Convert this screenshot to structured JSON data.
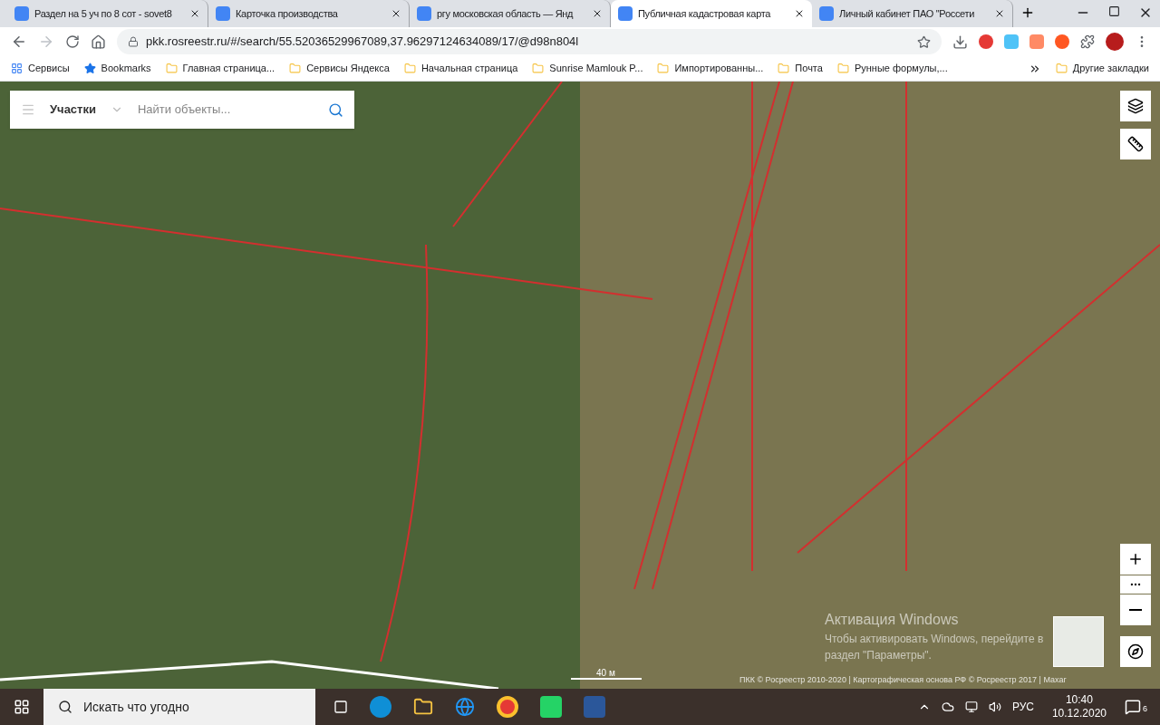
{
  "tabs": [
    {
      "title": "Раздел на 5 уч по 8 сот - sovet8",
      "selected": false
    },
    {
      "title": "Карточка производства",
      "selected": false
    },
    {
      "title": "ргу московская область — Янд",
      "selected": false
    },
    {
      "title": "Публичная кадастровая карта",
      "selected": true
    },
    {
      "title": "Личный кабинет ПАО \"Россети",
      "selected": false
    }
  ],
  "address": "pkk.rosreestr.ru/#/search/55.52036529967089,37.96297124634089/17/@d98n804l",
  "bookmarks": [
    "Сервисы",
    "Bookmarks",
    "Главная страница...",
    "Сервисы Яндекса",
    "Начальная страница",
    "Sunrise Mamlouk P...",
    "Импортированны...",
    "Почта",
    "Рунные формулы,..."
  ],
  "other_bookmarks": "Другие закладки",
  "search": {
    "category": "Участки",
    "placeholder": "Найти объекты..."
  },
  "scale": "40 м",
  "attribution": "ПКК © Росреестр 2010-2020 | Картографическая основа РФ © Росреестр 2017 | Maxar",
  "activation": {
    "title": "Активация Windows",
    "text": "Чтобы активировать Windows, перейдите в раздел \"Параметры\"."
  },
  "taskbar": {
    "search_placeholder": "Искать что угодно",
    "language": "РУС",
    "time": "10:40",
    "date": "10.12.2020",
    "notifications": "6"
  }
}
